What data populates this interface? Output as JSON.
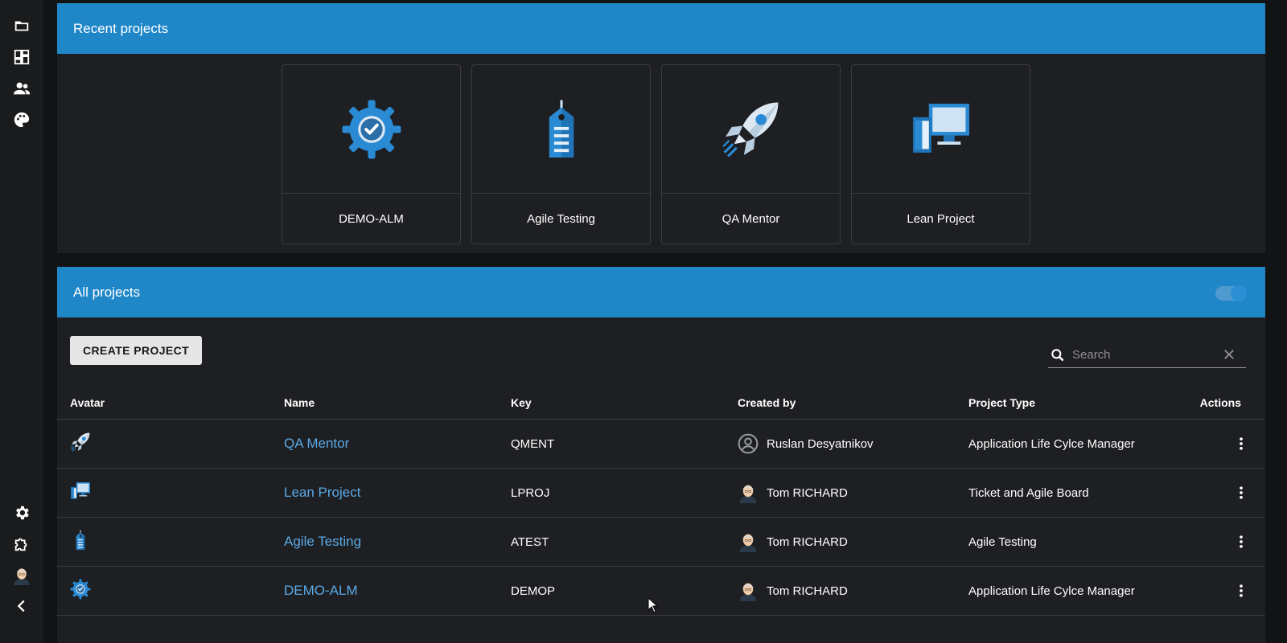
{
  "sidebar": {
    "top_items": [
      {
        "icon": "folder-icon"
      },
      {
        "icon": "dashboard-icon"
      },
      {
        "icon": "people-icon"
      },
      {
        "icon": "palette-icon"
      }
    ],
    "bottom_items": [
      {
        "icon": "gear-icon"
      },
      {
        "icon": "puzzle-icon"
      },
      {
        "icon": "user-avatar"
      },
      {
        "icon": "chevron-left-icon"
      }
    ]
  },
  "recent": {
    "title": "Recent projects",
    "cards": [
      {
        "label": "DEMO-ALM",
        "icon": "gear-check-icon"
      },
      {
        "label": "Agile Testing",
        "icon": "tag-icon"
      },
      {
        "label": "QA Mentor",
        "icon": "rocket-icon"
      },
      {
        "label": "Lean Project",
        "icon": "devices-icon"
      }
    ]
  },
  "all": {
    "title": "All projects",
    "create_label": "CREATE PROJECT",
    "search_placeholder": "Search",
    "columns": {
      "avatar": "Avatar",
      "name": "Name",
      "key": "Key",
      "created_by": "Created by",
      "project_type": "Project Type",
      "actions": "Actions"
    },
    "rows": [
      {
        "avatar": "rocket-icon",
        "name": "QA Mentor",
        "key": "QMENT",
        "created_by": "Ruslan Desyatnikov",
        "creator_avatar": "generic-user-icon",
        "type": "Application Life Cylce Manager"
      },
      {
        "avatar": "devices-icon",
        "name": "Lean Project",
        "key": "LPROJ",
        "created_by": "Tom RICHARD",
        "creator_avatar": "user-photo-avatar",
        "type": "Ticket and Agile Board"
      },
      {
        "avatar": "tag-icon",
        "name": "Agile Testing",
        "key": "ATEST",
        "created_by": "Tom RICHARD",
        "creator_avatar": "user-photo-avatar",
        "type": "Agile Testing"
      },
      {
        "avatar": "gear-check-icon",
        "name": "DEMO-ALM",
        "key": "DEMOP",
        "created_by": "Tom RICHARD",
        "creator_avatar": "user-photo-avatar",
        "type": "Application Life Cylce Manager"
      }
    ]
  },
  "colors": {
    "accent": "#1f87c8",
    "link": "#5aa9e6",
    "background": "#121314",
    "panel": "#1e1f22"
  }
}
